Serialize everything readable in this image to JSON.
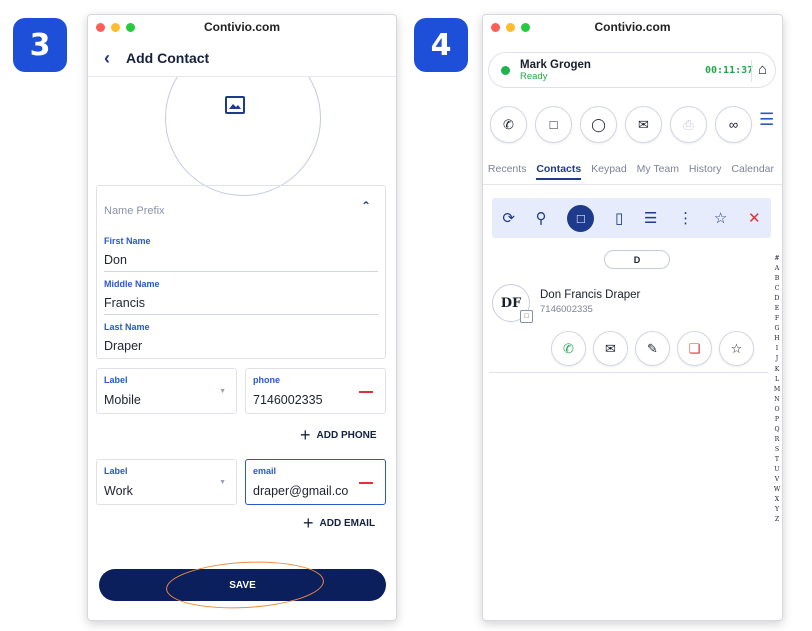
{
  "steps": [
    "3",
    "4"
  ],
  "left": {
    "window_title": "Contivio.com",
    "header": {
      "back_icon": "chevron-left-icon",
      "title": "Add Contact"
    },
    "name_prefix_placeholder": "Name Prefix",
    "first_name": {
      "label": "First Name",
      "value": "Don"
    },
    "middle_name": {
      "label": "Middle Name",
      "value": "Francis"
    },
    "last_name": {
      "label": "Last Name",
      "value": "Draper"
    },
    "phone": {
      "type_label": "Label",
      "type_value": "Mobile",
      "label": "phone",
      "value": "7146002335"
    },
    "add_phone": "ADD PHONE",
    "email": {
      "type_label": "Label",
      "type_value": "Work",
      "label": "email",
      "value": "draper@gmail.co"
    },
    "add_email": "ADD EMAIL",
    "save": "SAVE"
  },
  "right": {
    "window_title": "Contivio.com",
    "user": {
      "name": "Mark Grogen",
      "status": "Ready",
      "timer": "00:11:37"
    },
    "tabs": [
      "Recents",
      "Contacts",
      "Keypad",
      "My Team",
      "History",
      "Calendar"
    ],
    "active_tab": "Contacts",
    "letter_group": "D",
    "alphabet": [
      "#",
      "A",
      "B",
      "C",
      "D",
      "E",
      "F",
      "G",
      "H",
      "I",
      "J",
      "K",
      "L",
      "M",
      "N",
      "O",
      "P",
      "Q",
      "R",
      "S",
      "T",
      "U",
      "V",
      "W",
      "X",
      "Y",
      "Z"
    ],
    "contact": {
      "initials": "DF",
      "name": "Don Francis Draper",
      "phone": "7146002335"
    }
  },
  "colors": {
    "accent": "#1e3a8a",
    "primary_blue": "#2a57c9",
    "save_button": "#0b1f5c",
    "ready_green": "#22a84b",
    "danger": "#e0323a",
    "badge": "#1e4fd8",
    "annotation": "#f08a3e"
  }
}
